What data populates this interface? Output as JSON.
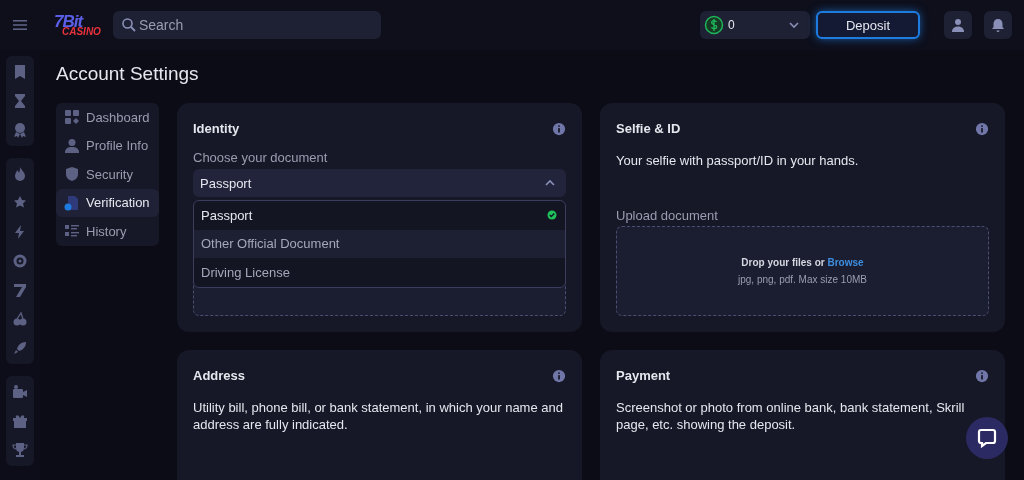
{
  "header": {
    "logo": {
      "text": "7Bit",
      "subtext": "CASINO"
    },
    "search": {
      "placeholder": "Search"
    },
    "balance": {
      "amount": "0"
    },
    "deposit_button": "Deposit"
  },
  "page_title": "Account Settings",
  "menu": [
    {
      "label": "Dashboard",
      "selected": false
    },
    {
      "label": "Profile Info",
      "selected": false
    },
    {
      "label": "Security",
      "selected": false
    },
    {
      "label": "Verification",
      "selected": true
    },
    {
      "label": "History",
      "selected": false
    }
  ],
  "cards": [
    {
      "kind": "select",
      "title": "Identity",
      "field_label": "Choose your document",
      "value": "Passport",
      "expanded": true,
      "options": [
        {
          "label": "Passport",
          "selected": true
        },
        {
          "label": "Other Official Document",
          "selected": false
        },
        {
          "label": "Driving License",
          "selected": false
        }
      ]
    },
    {
      "kind": "upload",
      "title": "Selfie & ID",
      "description": "Your selfie with passport/ID in your hands.",
      "upload_label": "Upload document",
      "drop_text": "Drop your files or",
      "browse_link": "Browse",
      "hint": "jpg, png, pdf. Max size 10MB"
    },
    {
      "kind": "text",
      "title": "Address",
      "description": "Utility bill, phone bill, or bank statement, in which your name and address are fully indicated."
    },
    {
      "kind": "text",
      "title": "Payment",
      "description": "Screenshot or photo from online bank, bank statement, Skrill page, etc. showing the deposit."
    }
  ]
}
